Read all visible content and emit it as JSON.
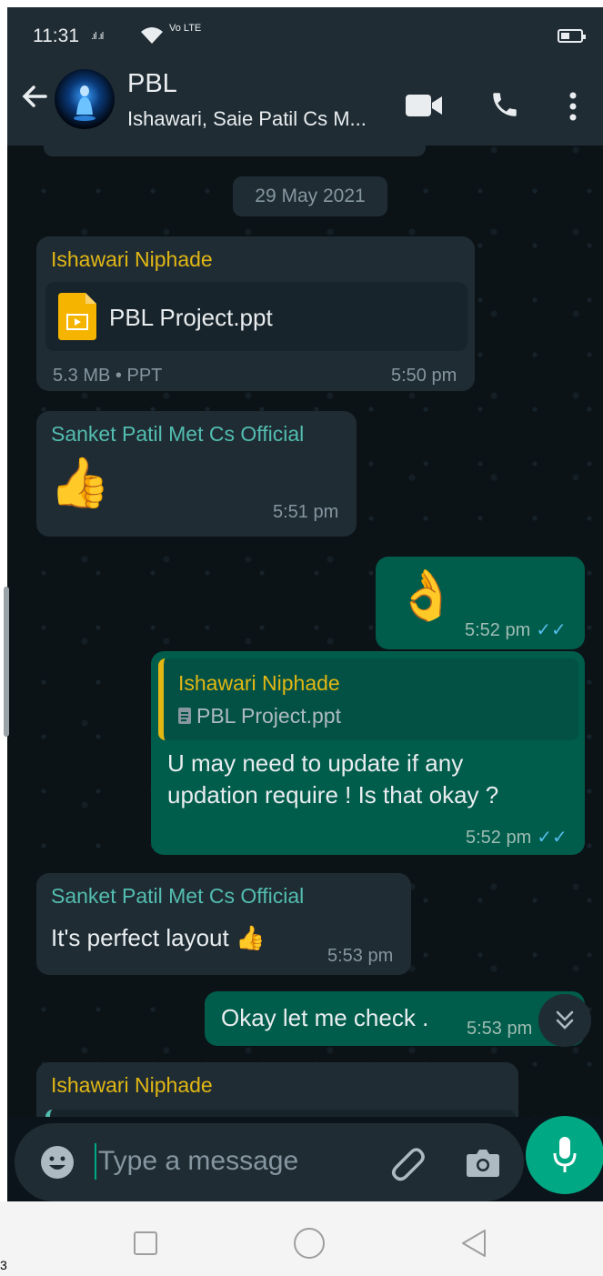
{
  "status_bar": {
    "time": "11:31",
    "signal": ".ıl .ıl",
    "network": "Vo LTE"
  },
  "header": {
    "title": "PBL",
    "subtitle": "Ishawari, Saie Patil Cs M..."
  },
  "date_chip": "29 May 2021",
  "messages": [
    {
      "sender": "Ishawari Niphade",
      "file_name": "PBL Project.ppt",
      "file_meta": "5.3 MB • PPT",
      "time": "5:50 pm"
    },
    {
      "sender": "Sanket Patil Met Cs Official",
      "emoji": "👍",
      "time": "5:51 pm"
    },
    {
      "emoji": "👌",
      "time": "5:52 pm"
    },
    {
      "quote_sender": "Ishawari Niphade",
      "quote_text": "PBL Project.ppt",
      "text_line1": "U may need to update if any",
      "text_line2": "updation require ! Is that okay ?",
      "time": "5:52 pm"
    },
    {
      "sender": "Sanket Patil Met Cs Official",
      "text": "It's perfect layout 👍",
      "time": "5:53 pm"
    },
    {
      "text": "Okay let me check .",
      "time": "5:53 pm"
    },
    {
      "sender": "Ishawari Niphade"
    }
  ],
  "input": {
    "placeholder": "Type a message"
  },
  "icons": [
    "back-arrow-icon",
    "video-call-icon",
    "phone-icon",
    "more-options-icon",
    "emoji-icon",
    "attach-icon",
    "camera-icon",
    "mic-icon",
    "scroll-down-icon",
    "file-ppt-icon",
    "document-icon",
    "read-ticks-icon"
  ],
  "colors": {
    "accent": "#00a884",
    "bubble_out": "#005c4b",
    "bubble_in": "#1f2c34",
    "sender_yellow": "#e2b714",
    "sender_cyan": "#53bdb0",
    "ticks": "#53bdeb"
  },
  "corner_mark": "3"
}
